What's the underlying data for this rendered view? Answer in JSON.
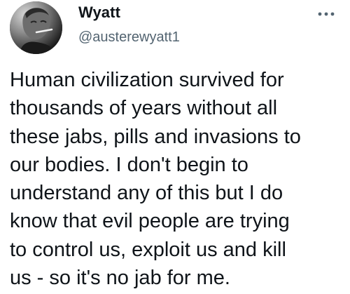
{
  "tweet": {
    "author": {
      "display_name": "Wyatt",
      "handle": "@austerewyatt1",
      "avatar_icon": "profile-photo"
    },
    "more_icon": "more-options-icon",
    "text": "Human civilization survived for\nthousands of years without all\nthese jabs, pills and invasions to\nour bodies. I don't begin to\nunderstand any of this but I do\nknow that evil people are trying\nto control us, exploit us and kill\nus - so it's no jab for me."
  },
  "colors": {
    "text_primary": "#0f1419",
    "text_secondary": "#536471",
    "background": "#ffffff"
  }
}
